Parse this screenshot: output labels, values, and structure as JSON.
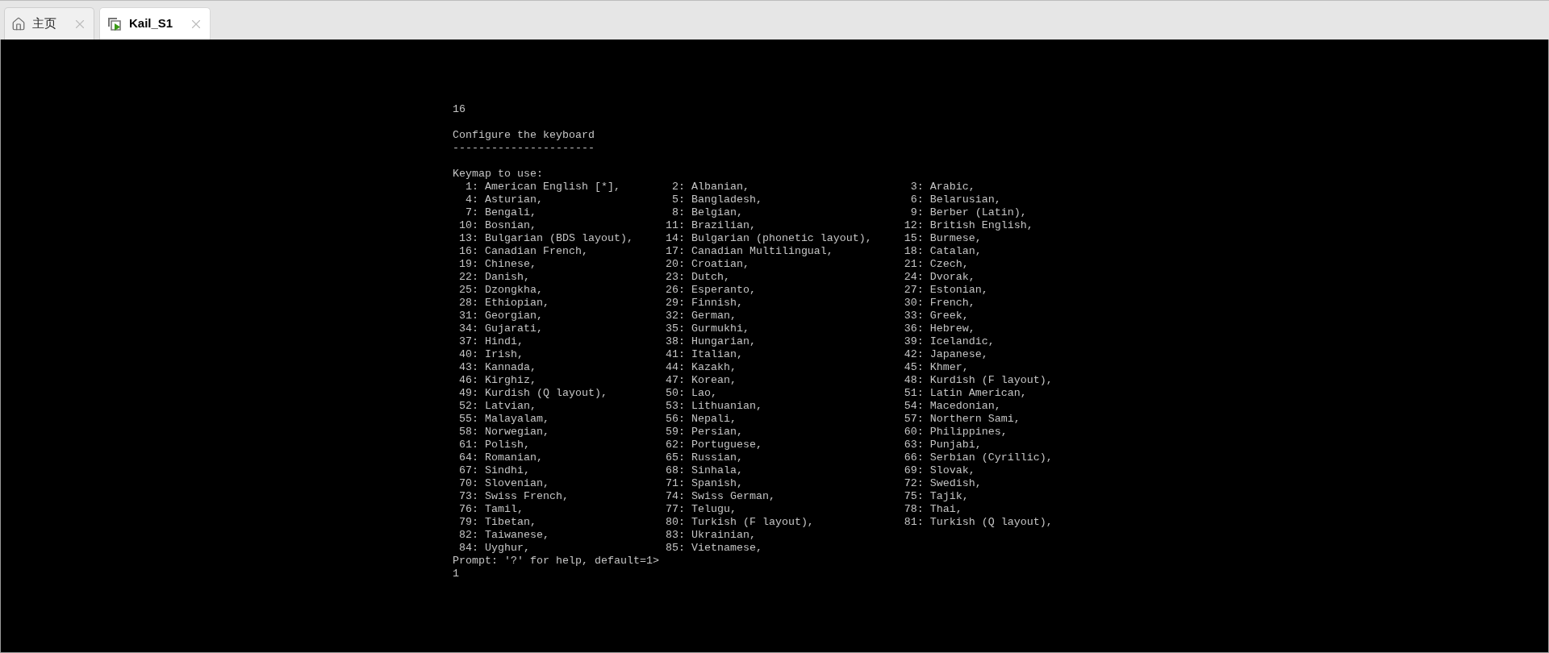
{
  "tabs": [
    {
      "label": "主页",
      "kind": "home",
      "selected": false
    },
    {
      "label": "Kail_S1",
      "kind": "vm",
      "selected": true
    }
  ],
  "console": {
    "lines_before": [
      "16"
    ],
    "heading": "Configure the keyboard",
    "underline": "----------------------",
    "intro": "Keymap to use:",
    "option_rows": [
      [
        {
          "number": "1:",
          "name": "American English [*],"
        },
        {
          "number": "2:",
          "name": "Albanian,"
        },
        {
          "number": "3:",
          "name": "Arabic,"
        }
      ],
      [
        {
          "number": "4:",
          "name": "Asturian,"
        },
        {
          "number": "5:",
          "name": "Bangladesh,"
        },
        {
          "number": "6:",
          "name": "Belarusian,"
        }
      ],
      [
        {
          "number": "7:",
          "name": "Bengali,"
        },
        {
          "number": "8:",
          "name": "Belgian,"
        },
        {
          "number": "9:",
          "name": "Berber (Latin),"
        }
      ],
      [
        {
          "number": "10:",
          "name": "Bosnian,"
        },
        {
          "number": "11:",
          "name": "Brazilian,"
        },
        {
          "number": "12:",
          "name": "British English,"
        }
      ],
      [
        {
          "number": "13:",
          "name": "Bulgarian (BDS layout),"
        },
        {
          "number": "14:",
          "name": "Bulgarian (phonetic layout),"
        },
        {
          "number": "15:",
          "name": "Burmese,"
        }
      ],
      [
        {
          "number": "16:",
          "name": "Canadian French,"
        },
        {
          "number": "17:",
          "name": "Canadian Multilingual,"
        },
        {
          "number": "18:",
          "name": "Catalan,"
        }
      ],
      [
        {
          "number": "19:",
          "name": "Chinese,"
        },
        {
          "number": "20:",
          "name": "Croatian,"
        },
        {
          "number": "21:",
          "name": "Czech,"
        }
      ],
      [
        {
          "number": "22:",
          "name": "Danish,"
        },
        {
          "number": "23:",
          "name": "Dutch,"
        },
        {
          "number": "24:",
          "name": "Dvorak,"
        }
      ],
      [
        {
          "number": "25:",
          "name": "Dzongkha,"
        },
        {
          "number": "26:",
          "name": "Esperanto,"
        },
        {
          "number": "27:",
          "name": "Estonian,"
        }
      ],
      [
        {
          "number": "28:",
          "name": "Ethiopian,"
        },
        {
          "number": "29:",
          "name": "Finnish,"
        },
        {
          "number": "30:",
          "name": "French,"
        }
      ],
      [
        {
          "number": "31:",
          "name": "Georgian,"
        },
        {
          "number": "32:",
          "name": "German,"
        },
        {
          "number": "33:",
          "name": "Greek,"
        }
      ],
      [
        {
          "number": "34:",
          "name": "Gujarati,"
        },
        {
          "number": "35:",
          "name": "Gurmukhi,"
        },
        {
          "number": "36:",
          "name": "Hebrew,"
        }
      ],
      [
        {
          "number": "37:",
          "name": "Hindi,"
        },
        {
          "number": "38:",
          "name": "Hungarian,"
        },
        {
          "number": "39:",
          "name": "Icelandic,"
        }
      ],
      [
        {
          "number": "40:",
          "name": "Irish,"
        },
        {
          "number": "41:",
          "name": "Italian,"
        },
        {
          "number": "42:",
          "name": "Japanese,"
        }
      ],
      [
        {
          "number": "43:",
          "name": "Kannada,"
        },
        {
          "number": "44:",
          "name": "Kazakh,"
        },
        {
          "number": "45:",
          "name": "Khmer,"
        }
      ],
      [
        {
          "number": "46:",
          "name": "Kirghiz,"
        },
        {
          "number": "47:",
          "name": "Korean,"
        },
        {
          "number": "48:",
          "name": "Kurdish (F layout),"
        }
      ],
      [
        {
          "number": "49:",
          "name": "Kurdish (Q layout),"
        },
        {
          "number": "50:",
          "name": "Lao,"
        },
        {
          "number": "51:",
          "name": "Latin American,"
        }
      ],
      [
        {
          "number": "52:",
          "name": "Latvian,"
        },
        {
          "number": "53:",
          "name": "Lithuanian,"
        },
        {
          "number": "54:",
          "name": "Macedonian,"
        }
      ],
      [
        {
          "number": "55:",
          "name": "Malayalam,"
        },
        {
          "number": "56:",
          "name": "Nepali,"
        },
        {
          "number": "57:",
          "name": "Northern Sami,"
        }
      ],
      [
        {
          "number": "58:",
          "name": "Norwegian,"
        },
        {
          "number": "59:",
          "name": "Persian,"
        },
        {
          "number": "60:",
          "name": "Philippines,"
        }
      ],
      [
        {
          "number": "61:",
          "name": "Polish,"
        },
        {
          "number": "62:",
          "name": "Portuguese,"
        },
        {
          "number": "63:",
          "name": "Punjabi,"
        }
      ],
      [
        {
          "number": "64:",
          "name": "Romanian,"
        },
        {
          "number": "65:",
          "name": "Russian,"
        },
        {
          "number": "66:",
          "name": "Serbian (Cyrillic),"
        }
      ],
      [
        {
          "number": "67:",
          "name": "Sindhi,"
        },
        {
          "number": "68:",
          "name": "Sinhala,"
        },
        {
          "number": "69:",
          "name": "Slovak,"
        }
      ],
      [
        {
          "number": "70:",
          "name": "Slovenian,"
        },
        {
          "number": "71:",
          "name": "Spanish,"
        },
        {
          "number": "72:",
          "name": "Swedish,"
        }
      ],
      [
        {
          "number": "73:",
          "name": "Swiss French,"
        },
        {
          "number": "74:",
          "name": "Swiss German,"
        },
        {
          "number": "75:",
          "name": "Tajik,"
        }
      ],
      [
        {
          "number": "76:",
          "name": "Tamil,"
        },
        {
          "number": "77:",
          "name": "Telugu,"
        },
        {
          "number": "78:",
          "name": "Thai,"
        }
      ],
      [
        {
          "number": "79:",
          "name": "Tibetan,"
        },
        {
          "number": "80:",
          "name": "Turkish (F layout),"
        },
        {
          "number": "81:",
          "name": "Turkish (Q layout),"
        }
      ],
      [
        {
          "number": "82:",
          "name": "Taiwanese,"
        },
        {
          "number": "83:",
          "name": "Ukrainian,"
        }
      ],
      [
        {
          "number": "84:",
          "name": "Uyghur,"
        },
        {
          "number": "85:",
          "name": "Vietnamese,"
        }
      ]
    ],
    "prompt": "Prompt: '?' for help, default=1>",
    "input": "1"
  }
}
